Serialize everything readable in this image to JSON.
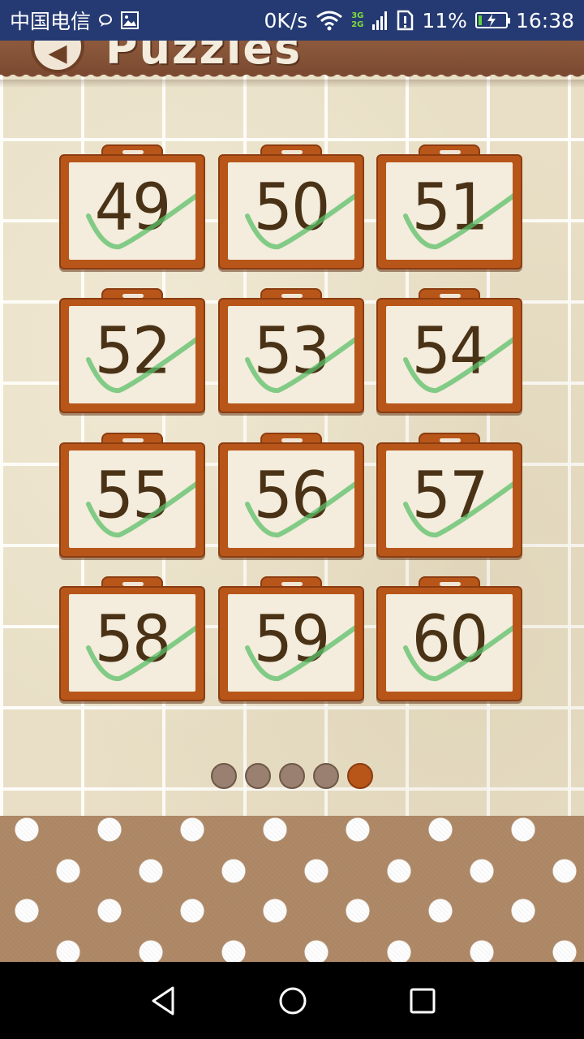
{
  "status_bar": {
    "carrier": "中国电信",
    "net_speed": "0K/s",
    "net_type_top": "3G",
    "net_type_bottom": "2G",
    "battery_percent": "11%",
    "battery_level": 0.11,
    "time": "16:38",
    "icons": [
      "chat-bubble-icon",
      "image-icon",
      "wifi-icon",
      "signal-icon",
      "sim-alert-icon",
      "battery-charging-icon"
    ]
  },
  "header": {
    "title": "Puzzles",
    "back_icon": "back-arrow-icon"
  },
  "levels": [
    {
      "number": "49",
      "completed": true
    },
    {
      "number": "50",
      "completed": true
    },
    {
      "number": "51",
      "completed": true
    },
    {
      "number": "52",
      "completed": true
    },
    {
      "number": "53",
      "completed": true
    },
    {
      "number": "54",
      "completed": true
    },
    {
      "number": "55",
      "completed": true
    },
    {
      "number": "56",
      "completed": true
    },
    {
      "number": "57",
      "completed": true
    },
    {
      "number": "58",
      "completed": true
    },
    {
      "number": "59",
      "completed": true
    },
    {
      "number": "60",
      "completed": true
    }
  ],
  "pagination": {
    "total_pages": 5,
    "current_page": 5
  },
  "colors": {
    "card_frame": "#b8561a",
    "number_ink": "#4a3216",
    "check_mark": "#5cc06a",
    "active_dot": "#b8561a",
    "inactive_dot": "#9a8070"
  },
  "nav_bar": {
    "icons": [
      "back-triangle-icon",
      "home-circle-icon",
      "recents-square-icon"
    ]
  }
}
